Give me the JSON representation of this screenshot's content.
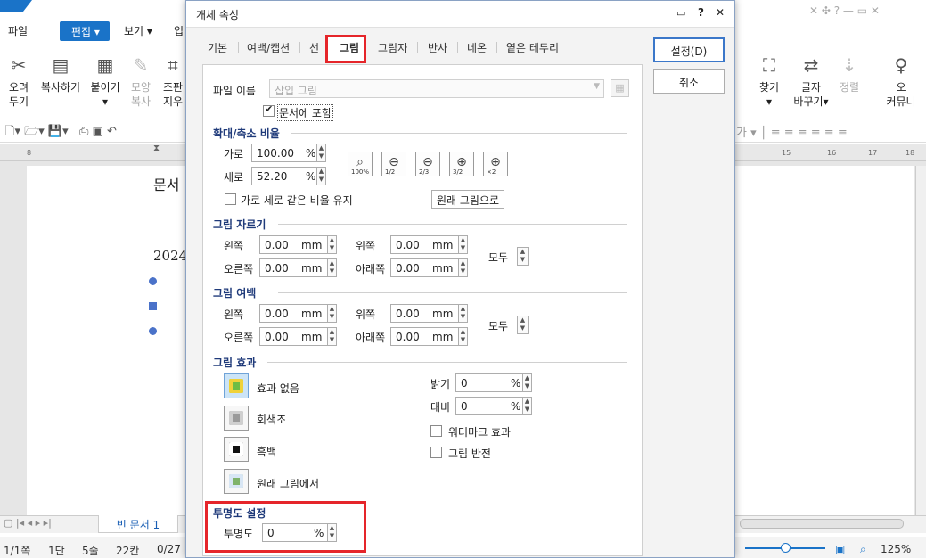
{
  "app": {
    "menu": {
      "file": "파일",
      "edit": "편집",
      "view": "보기",
      "input": "입"
    },
    "ribbon": {
      "cut": [
        "오려",
        "두기"
      ],
      "copy": "복사하기",
      "paste": "붙이기",
      "format_copy": [
        "모양",
        "복사"
      ],
      "clear": [
        "조판",
        "지우"
      ],
      "find": "찾기",
      "replace": [
        "글자",
        "바꾸기"
      ],
      "align": "정렬",
      "community": [
        "오",
        "커뮤니"
      ]
    },
    "doc": {
      "line1": "문서",
      "line2": "2024"
    },
    "doc_tab": "빈 문서 1",
    "status": {
      "page": "1/1쪽",
      "section": "1단",
      "line": "5줄",
      "col": "22칸",
      "pos": "0/27",
      "zoom": "125%"
    },
    "ruler_marks": [
      "8",
      "1",
      "15",
      "16",
      "17",
      "18"
    ]
  },
  "dialog": {
    "title": "개체 속성",
    "title_icons": {
      "help": "?",
      "close": "✕",
      "chat": "▭"
    },
    "tabs": [
      "기본",
      "여백/캡션",
      "선",
      "그림",
      "그림자",
      "반사",
      "네온",
      "옅은 테두리"
    ],
    "active_tab": "그림",
    "ok_button": "설정(D)",
    "cancel_button": "취소",
    "file": {
      "label": "파일 이름",
      "placeholder": "삽입 그림",
      "embed_label": "문서에 포함",
      "embed_checked": true
    },
    "scale": {
      "title": "확대/축소 비율",
      "width_label": "가로",
      "width_value": "100.00",
      "width_unit": "%",
      "height_label": "세로",
      "height_value": "52.20",
      "height_unit": "%",
      "keep_ratio": "가로 세로 같은 비율 유지",
      "original_button": "원래 그림으로",
      "zoom_buttons": [
        "100%",
        "1/2",
        "2/3",
        "3/2",
        "×2"
      ]
    },
    "crop": {
      "title": "그림 자르기",
      "left_label": "왼쪽",
      "left_value": "0.00",
      "right_label": "오른쪽",
      "right_value": "0.00",
      "top_label": "위쪽",
      "top_value": "0.00",
      "bottom_label": "아래쪽",
      "bottom_value": "0.00",
      "unit": "mm",
      "all_label": "모두"
    },
    "margin": {
      "title": "그림 여백",
      "left_label": "왼쪽",
      "left_value": "0.00",
      "right_label": "오른쪽",
      "right_value": "0.00",
      "top_label": "위쪽",
      "top_value": "0.00",
      "bottom_label": "아래쪽",
      "bottom_value": "0.00",
      "unit": "mm",
      "all_label": "모두"
    },
    "effect": {
      "title": "그림 효과",
      "none": "효과 없음",
      "gray": "회색조",
      "bw": "흑백",
      "original": "원래 그림에서",
      "brightness_label": "밝기",
      "brightness_value": "0",
      "contrast_label": "대비",
      "contrast_value": "0",
      "unit": "%",
      "watermark": "워터마크 효과",
      "invert": "그림 반전"
    },
    "transparency": {
      "title": "투명도 설정",
      "label": "투명도",
      "value": "0",
      "unit": "%"
    },
    "colors": {
      "accent": "#1a73c8",
      "highlight": "#e5252a",
      "section_title": "#1f3a7a"
    }
  }
}
